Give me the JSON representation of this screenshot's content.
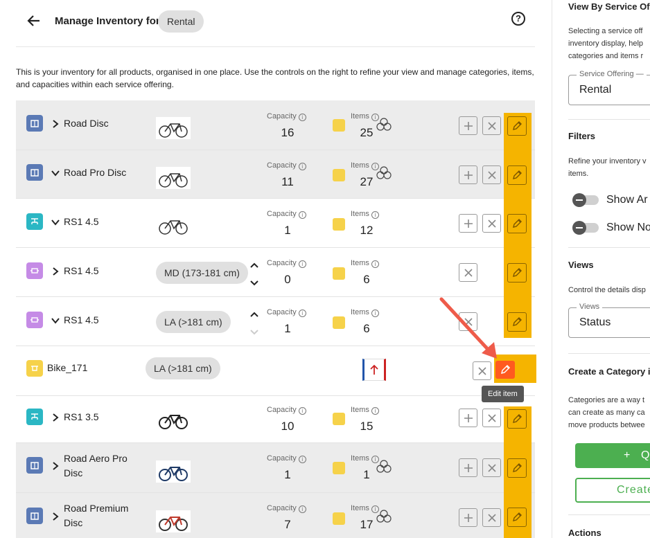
{
  "header": {
    "title": "Manage Inventory for",
    "chip": "Rental"
  },
  "description": "This is your inventory for all products, organised in one place. Use the controls on the right to refine your view and manage categories, items, and capacities within each service offering.",
  "labels": {
    "capacity": "Capacity",
    "items": "Items"
  },
  "rows": [
    {
      "name": "Road Disc",
      "capacity": "16",
      "items": "25"
    },
    {
      "name": "Road Pro Disc",
      "capacity": "11",
      "items": "27"
    },
    {
      "name": "RS1 4.5",
      "capacity": "1",
      "items": "12"
    },
    {
      "name": "RS1 4.5",
      "size": "MD (173-181 cm)",
      "capacity": "0",
      "items": "6"
    },
    {
      "name": "RS1 4.5",
      "size": "LA (>181 cm)",
      "capacity": "1",
      "items": "6"
    },
    {
      "name": "Bike_171",
      "size": "LA (>181 cm)"
    },
    {
      "name": "RS1 3.5",
      "capacity": "10",
      "items": "15"
    },
    {
      "name": "Road Aero Pro Disc",
      "capacity": "1",
      "items": "1"
    },
    {
      "name": "Road Premium Disc",
      "capacity": "7",
      "items": "17"
    }
  ],
  "tooltip": "Edit item",
  "sidebar": {
    "view_by_title": "View By Service Of",
    "view_by_desc": [
      "Selecting a service off",
      "inventory display, help",
      "categories and items r"
    ],
    "service_field_label": "Service Offering —",
    "service_field_value": "Rental",
    "filters_title": "Filters",
    "filters_desc": [
      "Refine your inventory v",
      "items."
    ],
    "toggle1": "Show Ar",
    "toggle2": "Show No",
    "views_title": "Views",
    "views_desc": "Control the details disp",
    "views_field_label": "Views",
    "views_field_value": "Status",
    "create_title": "Create a Category i",
    "create_desc": [
      "Categories are a way t",
      "can create as many ca",
      "move products betwee"
    ],
    "green_button": "Q",
    "outline_button": "Create",
    "actions_title": "Actions"
  },
  "colors": {
    "accent_orange": "#f5b400",
    "edit_red": "#ff5a1f",
    "green": "#4caf50",
    "icon_blue": "#5b7ab5",
    "icon_teal": "#2bb7c4",
    "icon_purple": "#c58be6",
    "icon_yellow": "#f6d24a"
  }
}
